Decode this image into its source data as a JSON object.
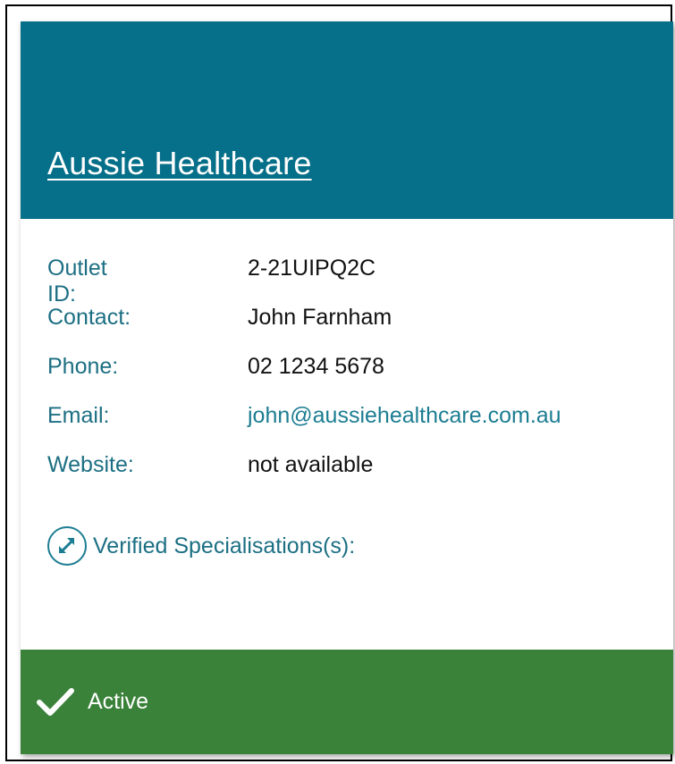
{
  "card": {
    "title": "Aussie Healthcare",
    "details": [
      {
        "label": "Outlet ID:",
        "value": "2-21UIPQ2C"
      },
      {
        "label": "Contact:",
        "value": "John Farnham"
      },
      {
        "label": "Phone:",
        "value": "02 1234 5678"
      },
      {
        "label": "Email:",
        "value": "john@aussiehealthcare.com.au"
      },
      {
        "label": "Website:",
        "value": "not available"
      }
    ],
    "specialisations_label": "Verified Specialisations(s):",
    "status": "Active"
  },
  "colors": {
    "header": "#066f89",
    "label_text": "#1c6f83",
    "link_text": "#1c7d92",
    "footer": "#3a813a"
  },
  "icons": {
    "expand": "expand-arrows-icon",
    "status": "checkmark-icon"
  }
}
